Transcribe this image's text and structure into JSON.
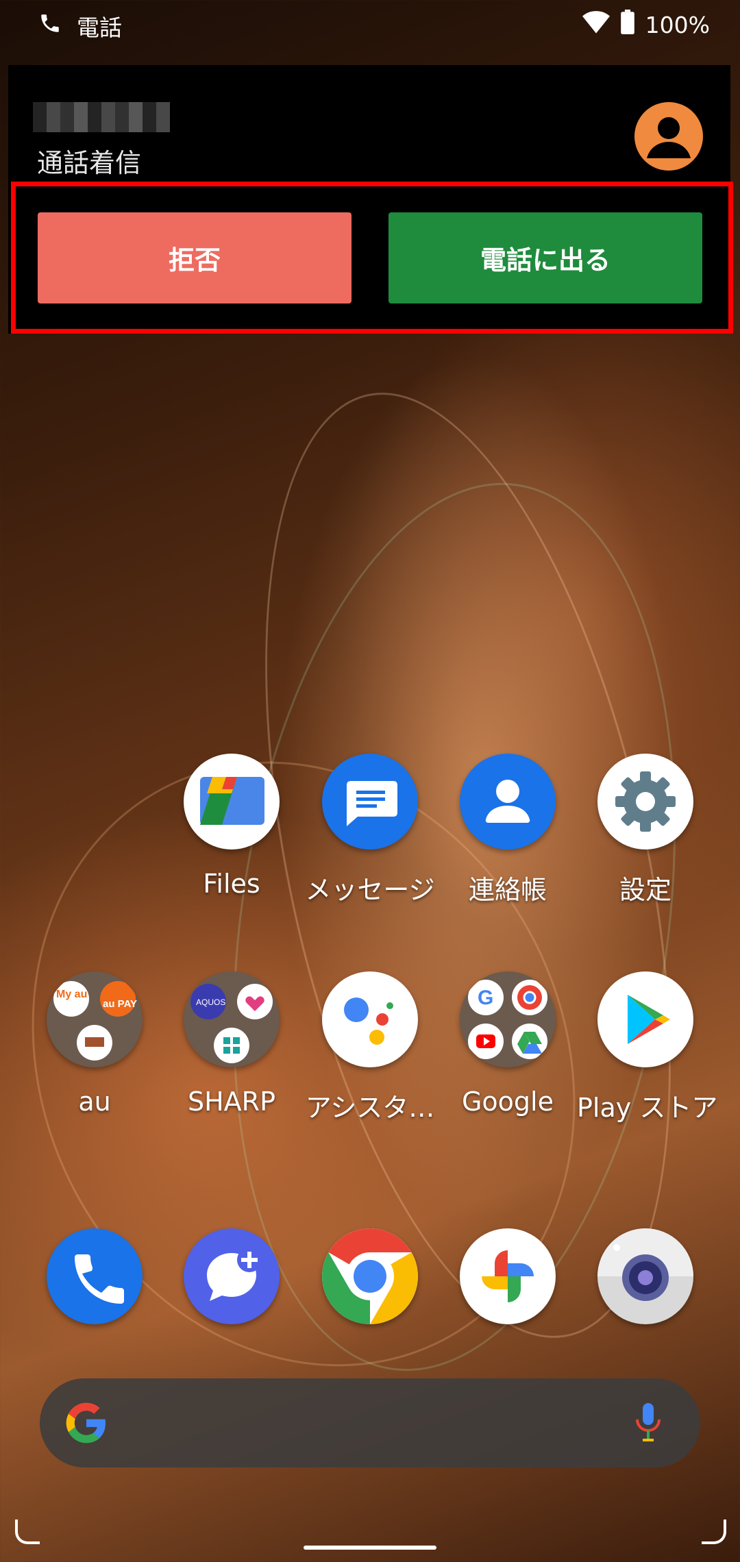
{
  "status_bar": {
    "app_name": "電話",
    "battery": "100%"
  },
  "incoming_call": {
    "status": "通話着信",
    "reject_label": "拒否",
    "accept_label": "電話に出る"
  },
  "home": {
    "row1": [
      {
        "label": "Files"
      },
      {
        "label": "メッセージ"
      },
      {
        "label": "連絡帳"
      },
      {
        "label": "設定"
      }
    ],
    "row2": [
      {
        "label": "au",
        "sub": [
          "My au",
          "au PAY"
        ]
      },
      {
        "label": "SHARP",
        "sub": [
          "AQUOS"
        ]
      },
      {
        "label": "アシスタ…"
      },
      {
        "label": "Google"
      },
      {
        "label": "Play ストア"
      }
    ],
    "dock": [
      "phone-icon",
      "messages-plus-icon",
      "chrome-icon",
      "photos-icon",
      "camera-icon"
    ]
  },
  "colors": {
    "reject": "#ee6b60",
    "accept": "#1f8b3d",
    "highlight": "#ff0000",
    "avatar": "#f08a3e"
  }
}
